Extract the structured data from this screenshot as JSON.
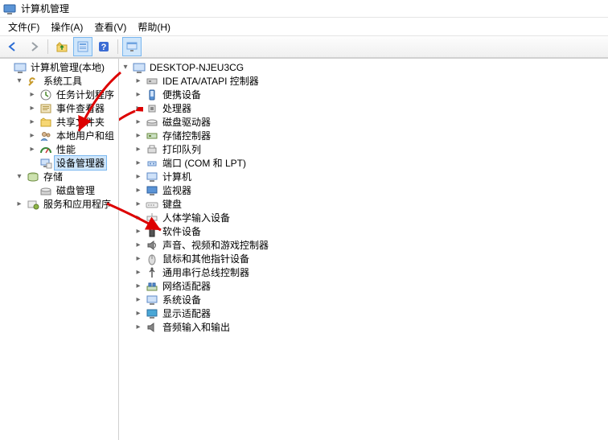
{
  "window": {
    "title": "计算机管理"
  },
  "menu": {
    "file": "文件(F)",
    "action": "操作(A)",
    "view": "查看(V)",
    "help": "帮助(H)"
  },
  "toolbar": {
    "back": "back",
    "forward": "forward",
    "up": "up-folder",
    "props": "properties",
    "help": "help",
    "refresh": "refresh"
  },
  "left_tree": {
    "root": {
      "label": "计算机管理(本地)"
    },
    "system_tools": {
      "label": "系统工具",
      "children": [
        {
          "key": "task-scheduler",
          "label": "任务计划程序",
          "expandable": true
        },
        {
          "key": "event-viewer",
          "label": "事件查看器",
          "expandable": true
        },
        {
          "key": "shared-folders",
          "label": "共享文件夹",
          "expandable": true
        },
        {
          "key": "local-users",
          "label": "本地用户和组",
          "expandable": true
        },
        {
          "key": "performance",
          "label": "性能",
          "expandable": true
        },
        {
          "key": "device-manager",
          "label": "设备管理器",
          "expandable": false,
          "selected": true
        }
      ]
    },
    "storage": {
      "label": "存储",
      "children": [
        {
          "key": "disk-management",
          "label": "磁盘管理",
          "expandable": false
        }
      ]
    },
    "services": {
      "label": "服务和应用程序"
    }
  },
  "right_tree": {
    "root": {
      "label": "DESKTOP-NJEU3CG"
    },
    "items": [
      {
        "key": "ide-ata",
        "label": "IDE ATA/ATAPI 控制器",
        "expandable": true
      },
      {
        "key": "portable",
        "label": "便携设备",
        "expandable": true
      },
      {
        "key": "cpu",
        "label": "处理器",
        "expandable": true
      },
      {
        "key": "disk-drives",
        "label": "磁盘驱动器",
        "expandable": true
      },
      {
        "key": "storage-ctrl",
        "label": "存储控制器",
        "expandable": true
      },
      {
        "key": "print-queues",
        "label": "打印队列",
        "expandable": true
      },
      {
        "key": "ports",
        "label": "端口 (COM 和 LPT)",
        "expandable": true
      },
      {
        "key": "computer",
        "label": "计算机",
        "expandable": true
      },
      {
        "key": "monitors",
        "label": "监视器",
        "expandable": true
      },
      {
        "key": "keyboards",
        "label": "键盘",
        "expandable": true
      },
      {
        "key": "hid",
        "label": "人体学输入设备",
        "expandable": true
      },
      {
        "key": "software-dev",
        "label": "软件设备",
        "expandable": true
      },
      {
        "key": "sound",
        "label": "声音、视频和游戏控制器",
        "expandable": true
      },
      {
        "key": "mouse",
        "label": "鼠标和其他指针设备",
        "expandable": true
      },
      {
        "key": "usb",
        "label": "通用串行总线控制器",
        "expandable": true
      },
      {
        "key": "network",
        "label": "网络适配器",
        "expandable": true
      },
      {
        "key": "system-dev",
        "label": "系统设备",
        "expandable": true
      },
      {
        "key": "display",
        "label": "显示适配器",
        "expandable": true
      },
      {
        "key": "audio-io",
        "label": "音频输入和输出",
        "expandable": true
      }
    ]
  }
}
